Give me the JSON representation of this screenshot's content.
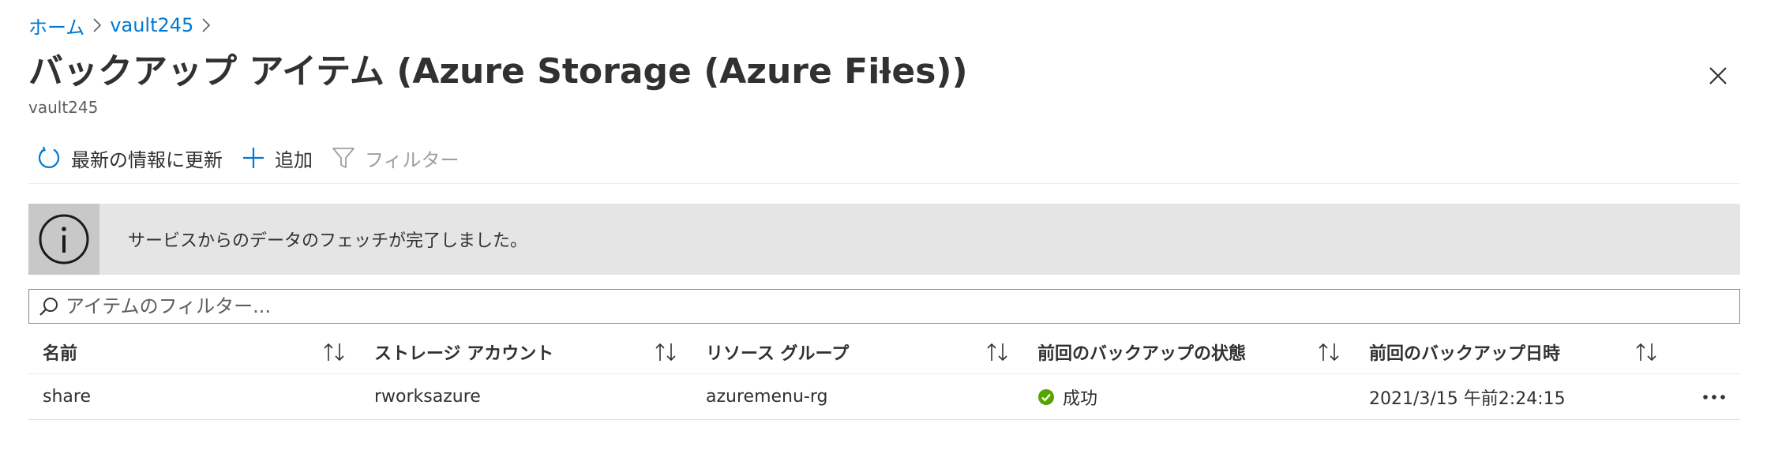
{
  "breadcrumb": {
    "home": "ホーム",
    "vault": "vault245"
  },
  "header": {
    "title": "バックアップ アイテム (Azure Storage (Azure Files))",
    "subtitle": "vault245"
  },
  "toolbar": {
    "refresh": "最新の情報に更新",
    "add": "追加",
    "filter": "フィルター"
  },
  "banner": {
    "text": "サービスからのデータのフェッチが完了しました。"
  },
  "filter": {
    "placeholder": "アイテムのフィルター..."
  },
  "table": {
    "columns": [
      "名前",
      "ストレージ アカウント",
      "リソース グループ",
      "前回のバックアップの状態",
      "前回のバックアップ日時"
    ],
    "rows": [
      {
        "name": "share",
        "storage_account": "rworksazure",
        "resource_group": "azuremenu-rg",
        "status": "成功",
        "last_backup": "2021/3/15 午前2:24:15"
      }
    ]
  },
  "colors": {
    "link": "#0078d4",
    "success": "#57a300",
    "banner_bg": "#e5e5e5"
  },
  "icons": [
    "chevron-right-icon",
    "ellipsis-icon",
    "close-icon",
    "refresh-icon",
    "plus-icon",
    "filter-icon",
    "info-icon",
    "search-icon",
    "sort-icon",
    "success-check-icon"
  ]
}
